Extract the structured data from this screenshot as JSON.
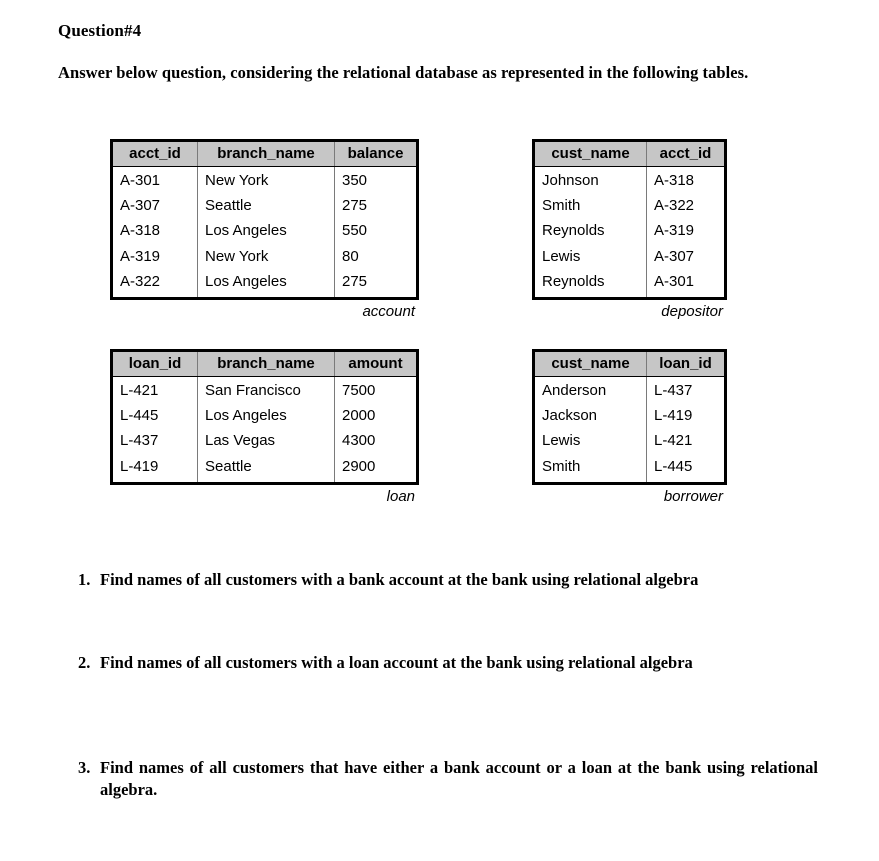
{
  "document": {
    "title": "Question#4",
    "intro": "Answer below question, considering the relational database as represented in the following tables."
  },
  "tables": {
    "account": {
      "caption": "account",
      "columns": [
        "acct_id",
        "branch_name",
        "balance"
      ],
      "rows": [
        [
          "A-301",
          "New York",
          "350"
        ],
        [
          "A-307",
          "Seattle",
          "275"
        ],
        [
          "A-318",
          "Los Angeles",
          "550"
        ],
        [
          "A-319",
          "New York",
          "80"
        ],
        [
          "A-322",
          "Los Angeles",
          "275"
        ]
      ]
    },
    "depositor": {
      "caption": "depositor",
      "columns": [
        "cust_name",
        "acct_id"
      ],
      "rows": [
        [
          "Johnson",
          "A-318"
        ],
        [
          "Smith",
          "A-322"
        ],
        [
          "Reynolds",
          "A-319"
        ],
        [
          "Lewis",
          "A-307"
        ],
        [
          "Reynolds",
          "A-301"
        ]
      ]
    },
    "loan": {
      "caption": "loan",
      "columns": [
        "loan_id",
        "branch_name",
        "amount"
      ],
      "rows": [
        [
          "L-421",
          "San Francisco",
          "7500"
        ],
        [
          "L-445",
          "Los Angeles",
          "2000"
        ],
        [
          "L-437",
          "Las Vegas",
          "4300"
        ],
        [
          "L-419",
          "Seattle",
          "2900"
        ]
      ]
    },
    "borrower": {
      "caption": "borrower",
      "columns": [
        "cust_name",
        "loan_id"
      ],
      "rows": [
        [
          "Anderson",
          "L-437"
        ],
        [
          "Jackson",
          "L-419"
        ],
        [
          "Lewis",
          "L-421"
        ],
        [
          "Smith",
          "L-445"
        ]
      ]
    }
  },
  "questions": [
    {
      "marker": "1.",
      "text": "Find names of all customers with a bank account at the bank using relational algebra"
    },
    {
      "marker": "2.",
      "text": "Find names of all customers with a loan account at the bank using relational algebra"
    },
    {
      "marker": "3.",
      "text": "Find names of all customers that have either a bank account or a loan at the bank using relational algebra."
    }
  ],
  "colors": {
    "header_fill": "#c6c6c6",
    "border": "#000000",
    "grid_line": "#7a7a7a",
    "text": "#000000",
    "background": "#ffffff"
  }
}
